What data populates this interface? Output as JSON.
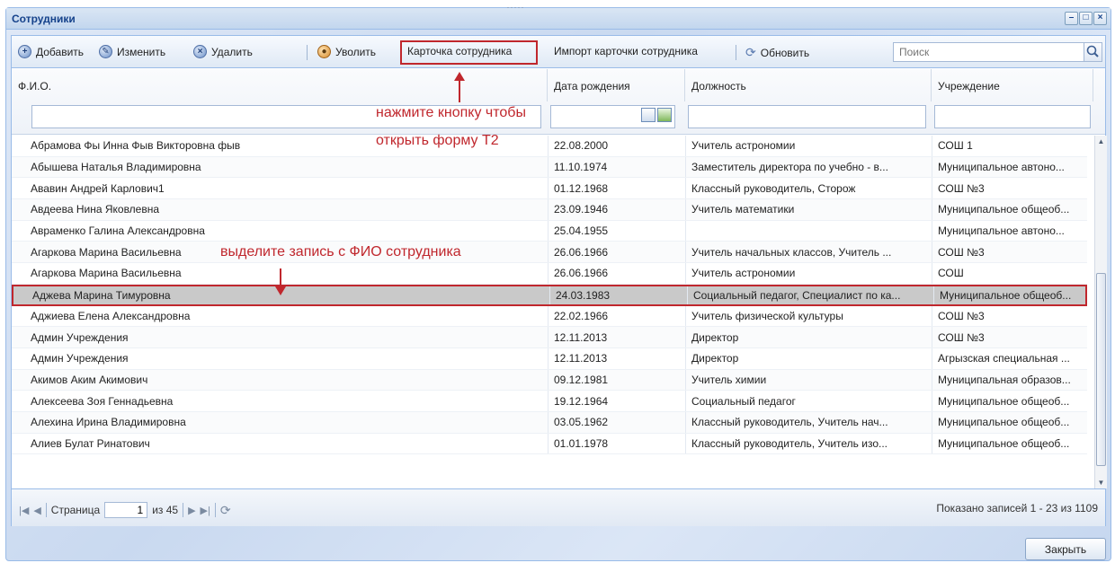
{
  "window": {
    "title": "Сотрудники"
  },
  "toolbar": {
    "add": "Добавить",
    "edit": "Изменить",
    "delete": "Удалить",
    "dismiss": "Уволить",
    "card": "Карточка сотрудника",
    "import": "Импорт карточки сотрудника",
    "refresh": "Обновить",
    "search_placeholder": "Поиск"
  },
  "columns": [
    "Ф.И.О.",
    "Дата рождения",
    "Должность",
    "Учреждение"
  ],
  "rows": [
    [
      "Абрамова Фы Инна Фыв Викторовна фыв",
      "22.08.2000",
      "Учитель астрономии",
      "СОШ 1"
    ],
    [
      "Абышева Наталья Владимировна",
      "11.10.1974",
      "Заместитель директора по учебно - в...",
      "Муниципальное автоно..."
    ],
    [
      "Ававин Андрей Карлович1",
      "01.12.1968",
      "Классный руководитель, Сторож",
      "СОШ №3"
    ],
    [
      "Авдеева Нина Яковлевна",
      "23.09.1946",
      "Учитель математики",
      "Муниципальное общеоб..."
    ],
    [
      "Авраменко Галина Александровна",
      "25.04.1955",
      "",
      "Муниципальное автоно..."
    ],
    [
      "Агаркова Марина Васильевна",
      "26.06.1966",
      "Учитель начальных классов, Учитель ...",
      "СОШ №3"
    ],
    [
      "Агаркова Марина Васильевна",
      "26.06.1966",
      "Учитель астрономии",
      "СОШ"
    ],
    [
      "Аджева Марина Тимуровна",
      "24.03.1983",
      "Социальный педагог, Специалист по ка...",
      "Муниципальное общеоб..."
    ],
    [
      "Аджиева Елена Александровна",
      "22.02.1966",
      "Учитель физической культуры",
      "СОШ №3"
    ],
    [
      "Админ Учреждения",
      "12.11.2013",
      "Директор",
      "СОШ №3"
    ],
    [
      "Админ Учреждения",
      "12.11.2013",
      "Директор",
      "Агрызская специальная ..."
    ],
    [
      "Акимов Аким Акимович",
      "09.12.1981",
      "Учитель химии",
      "Муниципальная образов..."
    ],
    [
      "Алексеева Зоя Геннадьевна",
      "19.12.1964",
      "Социальный педагог",
      "Муниципальное общеоб..."
    ],
    [
      "Алехина Ирина Владимировна",
      "03.05.1962",
      "Классный руководитель, Учитель нач...",
      "Муниципальное общеоб..."
    ],
    [
      "Алиев Булат Ринатович",
      "01.01.1978",
      "Классный руководитель, Учитель изо...",
      "Муниципальное общеоб..."
    ]
  ],
  "selected_row_index": 7,
  "pager": {
    "page_label": "Страница",
    "page_value": "1",
    "of_label": "из 45",
    "status": "Показано записей 1 - 23 из 1109"
  },
  "footer": {
    "close": "Закрыть"
  },
  "annotations": {
    "button_hint_line1": "нажмите кнопку чтобы",
    "button_hint_line2": "открыть форму Т2",
    "row_hint": "выделите запись с ФИО сотрудника"
  },
  "colors": {
    "highlight": "#c0272d",
    "title": "#15428b"
  }
}
